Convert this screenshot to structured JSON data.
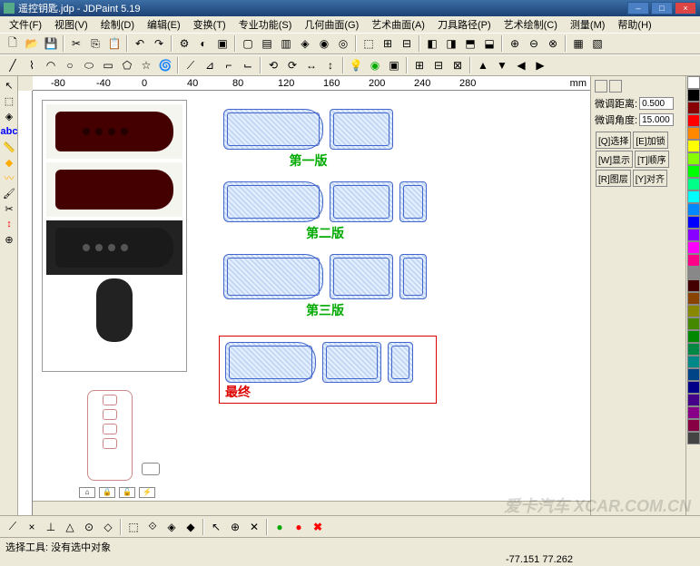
{
  "title": "遥控钥匙.jdp - JDPaint 5.19",
  "menu": [
    "文件(F)",
    "视图(V)",
    "绘制(D)",
    "编辑(E)",
    "变换(T)",
    "专业功能(S)",
    "几何曲面(G)",
    "艺术曲面(A)",
    "刀具路径(P)",
    "艺术绘制(C)",
    "测量(M)",
    "帮助(H)"
  ],
  "ruler_marks": [
    "-80",
    "-40",
    "0",
    "40",
    "80",
    "120",
    "160",
    "200",
    "240",
    "280"
  ],
  "ruler_unit": "mm",
  "panel": {
    "dist_label": "微调距离:",
    "dist_val": "0.500",
    "angle_label": "微调角度:",
    "angle_val": "15.000",
    "btns": [
      "[Q]选择",
      "[E]加锁",
      "[W]显示",
      "[T]顺序",
      "[R]图层",
      "[Y]对齐"
    ]
  },
  "labels": {
    "v1": "第一版",
    "v2": "第二版",
    "v3": "第三版",
    "final": "最终"
  },
  "status": {
    "line1": "选择工具: 没有选中对象",
    "coords": "-77.151  77.262"
  },
  "palette": [
    "#fff",
    "#000",
    "#800",
    "#f00",
    "#f80",
    "#ff0",
    "#8f0",
    "#0f0",
    "#0f8",
    "#0ff",
    "#08f",
    "#00f",
    "#80f",
    "#f0f",
    "#f08",
    "#888",
    "#400",
    "#840",
    "#880",
    "#480",
    "#080",
    "#084",
    "#088",
    "#048",
    "#008",
    "#408",
    "#808",
    "#804",
    "#444"
  ],
  "watermark": "爱卡汽车 XCAR.COM.CN"
}
